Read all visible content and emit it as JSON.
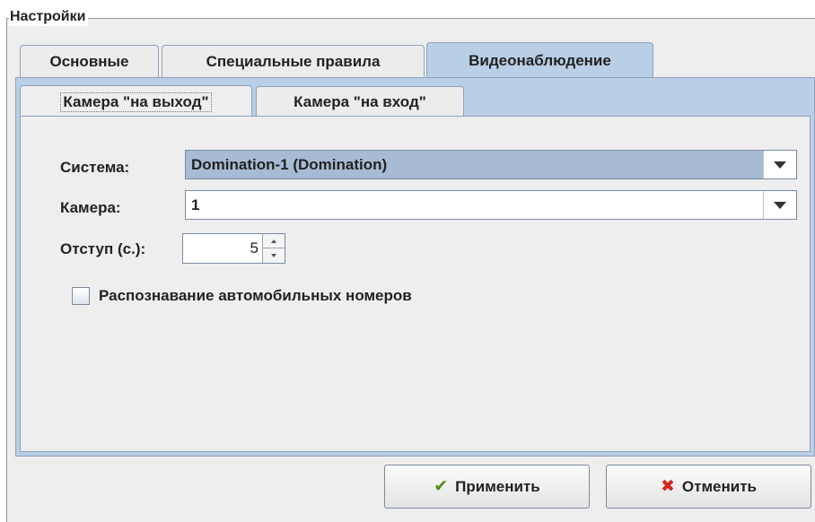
{
  "settings": {
    "title": "Настройки"
  },
  "tabs": [
    {
      "label": "Основные"
    },
    {
      "label": "Специальные правила"
    },
    {
      "label": "Видеонаблюдение"
    }
  ],
  "subtabs": [
    {
      "label": "Камера \"на выход\""
    },
    {
      "label": "Камера \"на вход\""
    }
  ],
  "form": {
    "system_label": "Система:",
    "system_value": "Domination-1 (Domination)",
    "camera_label": "Камера:",
    "camera_value": "1",
    "offset_label": "Отступ (с.):",
    "offset_value": "5",
    "plate_recognition_label": "Распознавание автомобильных номеров",
    "plate_recognition_checked": false
  },
  "buttons": {
    "apply_label": "Применить",
    "cancel_label": "Отменить"
  },
  "colors": {
    "tab_active": "#b8cfe5",
    "combo_selected": "#a7bbd4"
  }
}
